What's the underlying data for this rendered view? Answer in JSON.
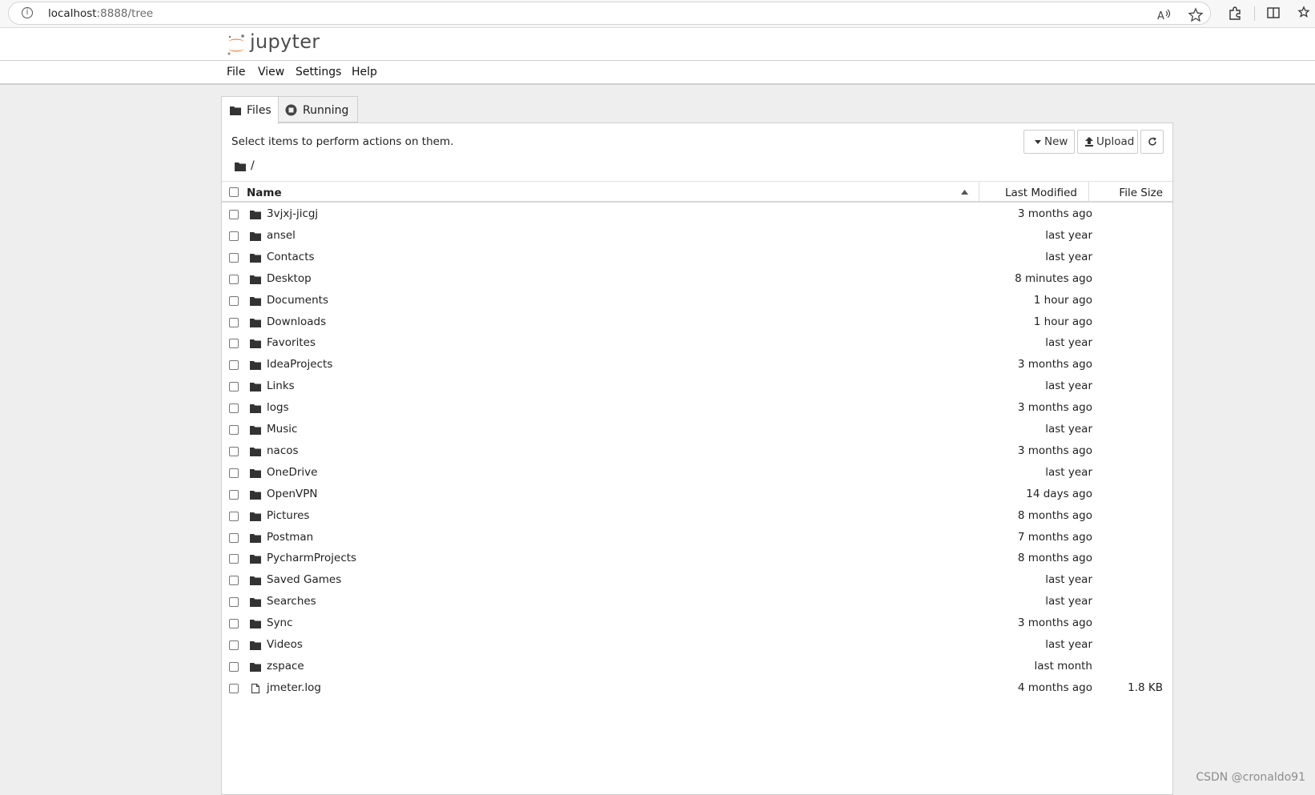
{
  "browser": {
    "url_host": "localhost",
    "url_rest": ":8888/tree"
  },
  "header": {
    "logo_text": "jupyter",
    "menu": [
      "File",
      "View",
      "Settings",
      "Help"
    ]
  },
  "tabs": [
    {
      "label": "Files",
      "icon": "folder-icon",
      "active": true
    },
    {
      "label": "Running",
      "icon": "stop-circle-icon",
      "active": false
    }
  ],
  "toolbar": {
    "hint": "Select items to perform actions on them.",
    "new_label": "New",
    "upload_label": "Upload",
    "breadcrumb": "/"
  },
  "columns": {
    "name": "Name",
    "modified": "Last Modified",
    "size": "File Size"
  },
  "files": [
    {
      "name": "3vjxj-jicgj",
      "type": "folder",
      "modified": "3 months ago",
      "size": ""
    },
    {
      "name": "ansel",
      "type": "folder",
      "modified": "last year",
      "size": ""
    },
    {
      "name": "Contacts",
      "type": "folder",
      "modified": "last year",
      "size": ""
    },
    {
      "name": "Desktop",
      "type": "folder",
      "modified": "8 minutes ago",
      "size": ""
    },
    {
      "name": "Documents",
      "type": "folder",
      "modified": "1 hour ago",
      "size": ""
    },
    {
      "name": "Downloads",
      "type": "folder",
      "modified": "1 hour ago",
      "size": ""
    },
    {
      "name": "Favorites",
      "type": "folder",
      "modified": "last year",
      "size": ""
    },
    {
      "name": "IdeaProjects",
      "type": "folder",
      "modified": "3 months ago",
      "size": ""
    },
    {
      "name": "Links",
      "type": "folder",
      "modified": "last year",
      "size": ""
    },
    {
      "name": "logs",
      "type": "folder",
      "modified": "3 months ago",
      "size": ""
    },
    {
      "name": "Music",
      "type": "folder",
      "modified": "last year",
      "size": ""
    },
    {
      "name": "nacos",
      "type": "folder",
      "modified": "3 months ago",
      "size": ""
    },
    {
      "name": "OneDrive",
      "type": "folder",
      "modified": "last year",
      "size": ""
    },
    {
      "name": "OpenVPN",
      "type": "folder",
      "modified": "14 days ago",
      "size": ""
    },
    {
      "name": "Pictures",
      "type": "folder",
      "modified": "8 months ago",
      "size": ""
    },
    {
      "name": "Postman",
      "type": "folder",
      "modified": "7 months ago",
      "size": ""
    },
    {
      "name": "PycharmProjects",
      "type": "folder",
      "modified": "8 months ago",
      "size": ""
    },
    {
      "name": "Saved Games",
      "type": "folder",
      "modified": "last year",
      "size": ""
    },
    {
      "name": "Searches",
      "type": "folder",
      "modified": "last year",
      "size": ""
    },
    {
      "name": "Sync",
      "type": "folder",
      "modified": "3 months ago",
      "size": ""
    },
    {
      "name": "Videos",
      "type": "folder",
      "modified": "last year",
      "size": ""
    },
    {
      "name": "zspace",
      "type": "folder",
      "modified": "last month",
      "size": ""
    },
    {
      "name": "jmeter.log",
      "type": "file",
      "modified": "4 months ago",
      "size": "1.8 KB"
    }
  ],
  "watermark": "CSDN @cronaldo91",
  "colors": {
    "jupyter_orange": "#f37726",
    "page_background": "#eeeeee"
  }
}
